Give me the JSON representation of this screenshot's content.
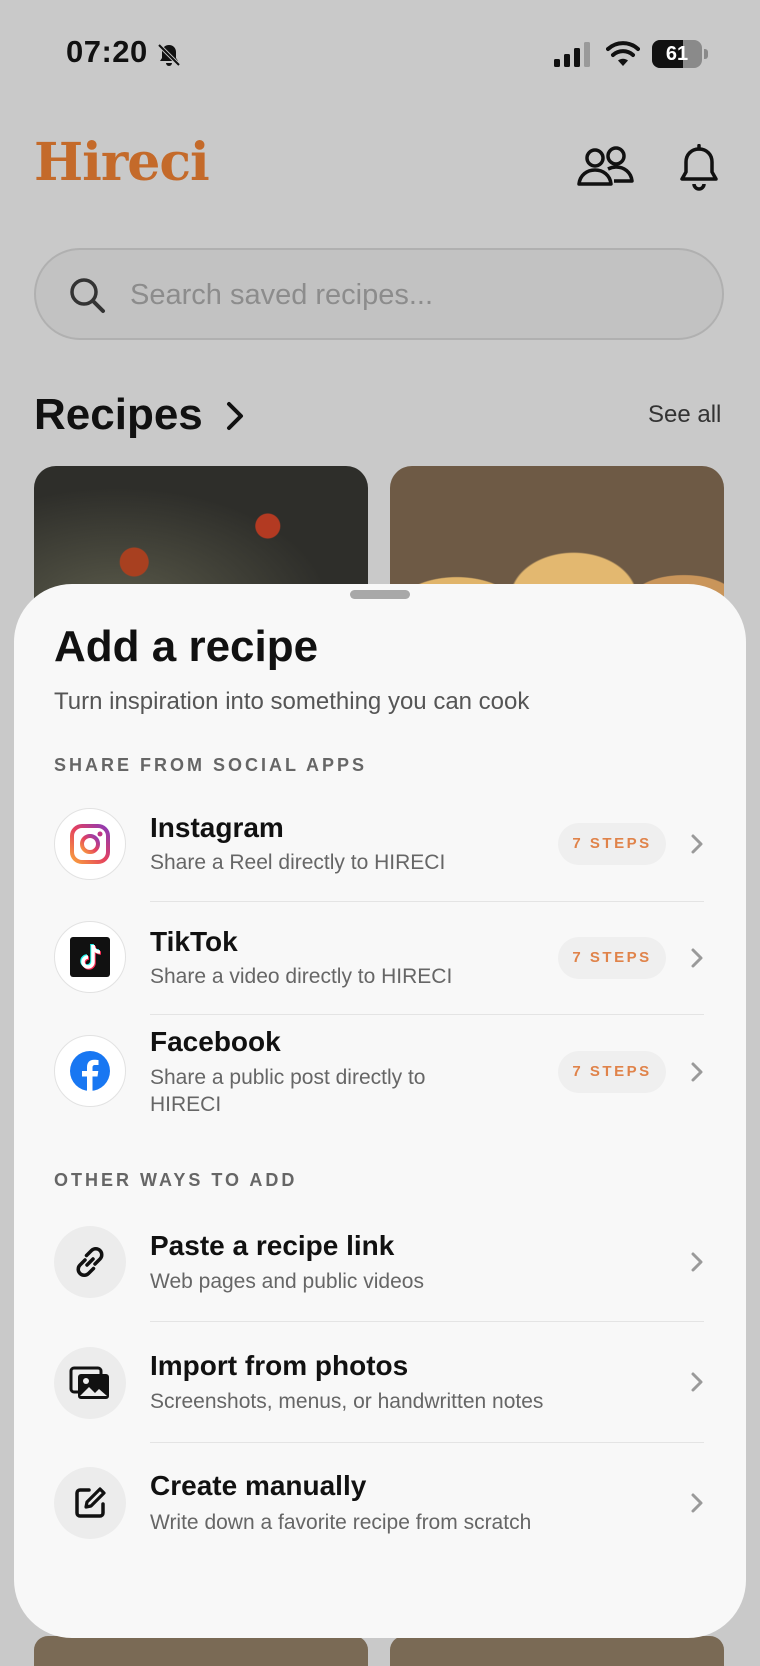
{
  "status_bar": {
    "time": "07:20",
    "battery": "61",
    "battery_level": 0.61
  },
  "header": {
    "logo": "Hireci"
  },
  "search": {
    "placeholder": "Search saved recipes..."
  },
  "recipes_section": {
    "title": "Recipes",
    "see_all": "See all"
  },
  "sheet": {
    "title": "Add a recipe",
    "subtitle": "Turn inspiration into something you can cook",
    "social_label": "SHARE FROM SOCIAL APPS",
    "social": [
      {
        "name": "Instagram",
        "desc": "Share a Reel directly to HIRECI",
        "badge": "7 STEPS",
        "icon": "instagram-icon"
      },
      {
        "name": "TikTok",
        "desc": "Share a video directly to HIRECI",
        "badge": "7 STEPS",
        "icon": "tiktok-icon"
      },
      {
        "name": "Facebook",
        "desc_line1": "Share a public post directly to",
        "desc_line2": "HIRECI",
        "badge": "7 STEPS",
        "icon": "facebook-icon"
      }
    ],
    "other_label": "OTHER WAYS TO ADD",
    "other": [
      {
        "name": "Paste a recipe link",
        "desc": "Web pages and public videos",
        "icon": "link-icon"
      },
      {
        "name": "Import from photos",
        "desc": "Screenshots, menus, or handwritten notes",
        "icon": "photos-icon"
      },
      {
        "name": "Create manually",
        "desc": "Write down a favorite recipe from scratch",
        "icon": "edit-icon"
      }
    ]
  },
  "colors": {
    "brand": "#c46a2a",
    "badge_text": "#e0834a",
    "facebook": "#1877f2"
  }
}
